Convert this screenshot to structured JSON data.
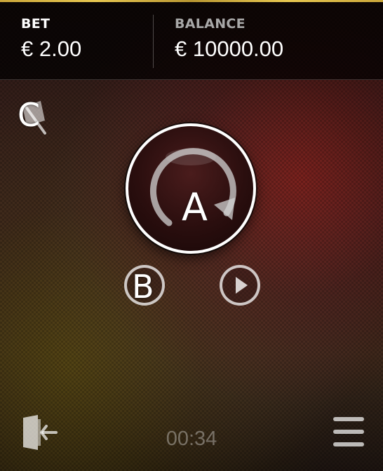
{
  "header": {
    "bet_label": "BET",
    "bet_value": "€ 2.00",
    "balance_label": "BALANCE",
    "balance_value": "€ 10000.00"
  },
  "controls": {
    "spin_label": "A",
    "secondary_label": "B",
    "corner_label": "C"
  },
  "footer": {
    "timer": "00:34"
  },
  "icons": {
    "spin": "refresh-arrow-icon",
    "secondary": "circle-button-icon",
    "play": "play-icon",
    "corner": "flag-icon",
    "exit": "exit-door-icon",
    "menu": "hamburger-menu-icon"
  },
  "colors": {
    "accent_gold": "#e6c650",
    "text_primary": "#ffffff",
    "text_secondary": "#a8a8a8",
    "spin_button_fill": "#2a0e0e"
  }
}
